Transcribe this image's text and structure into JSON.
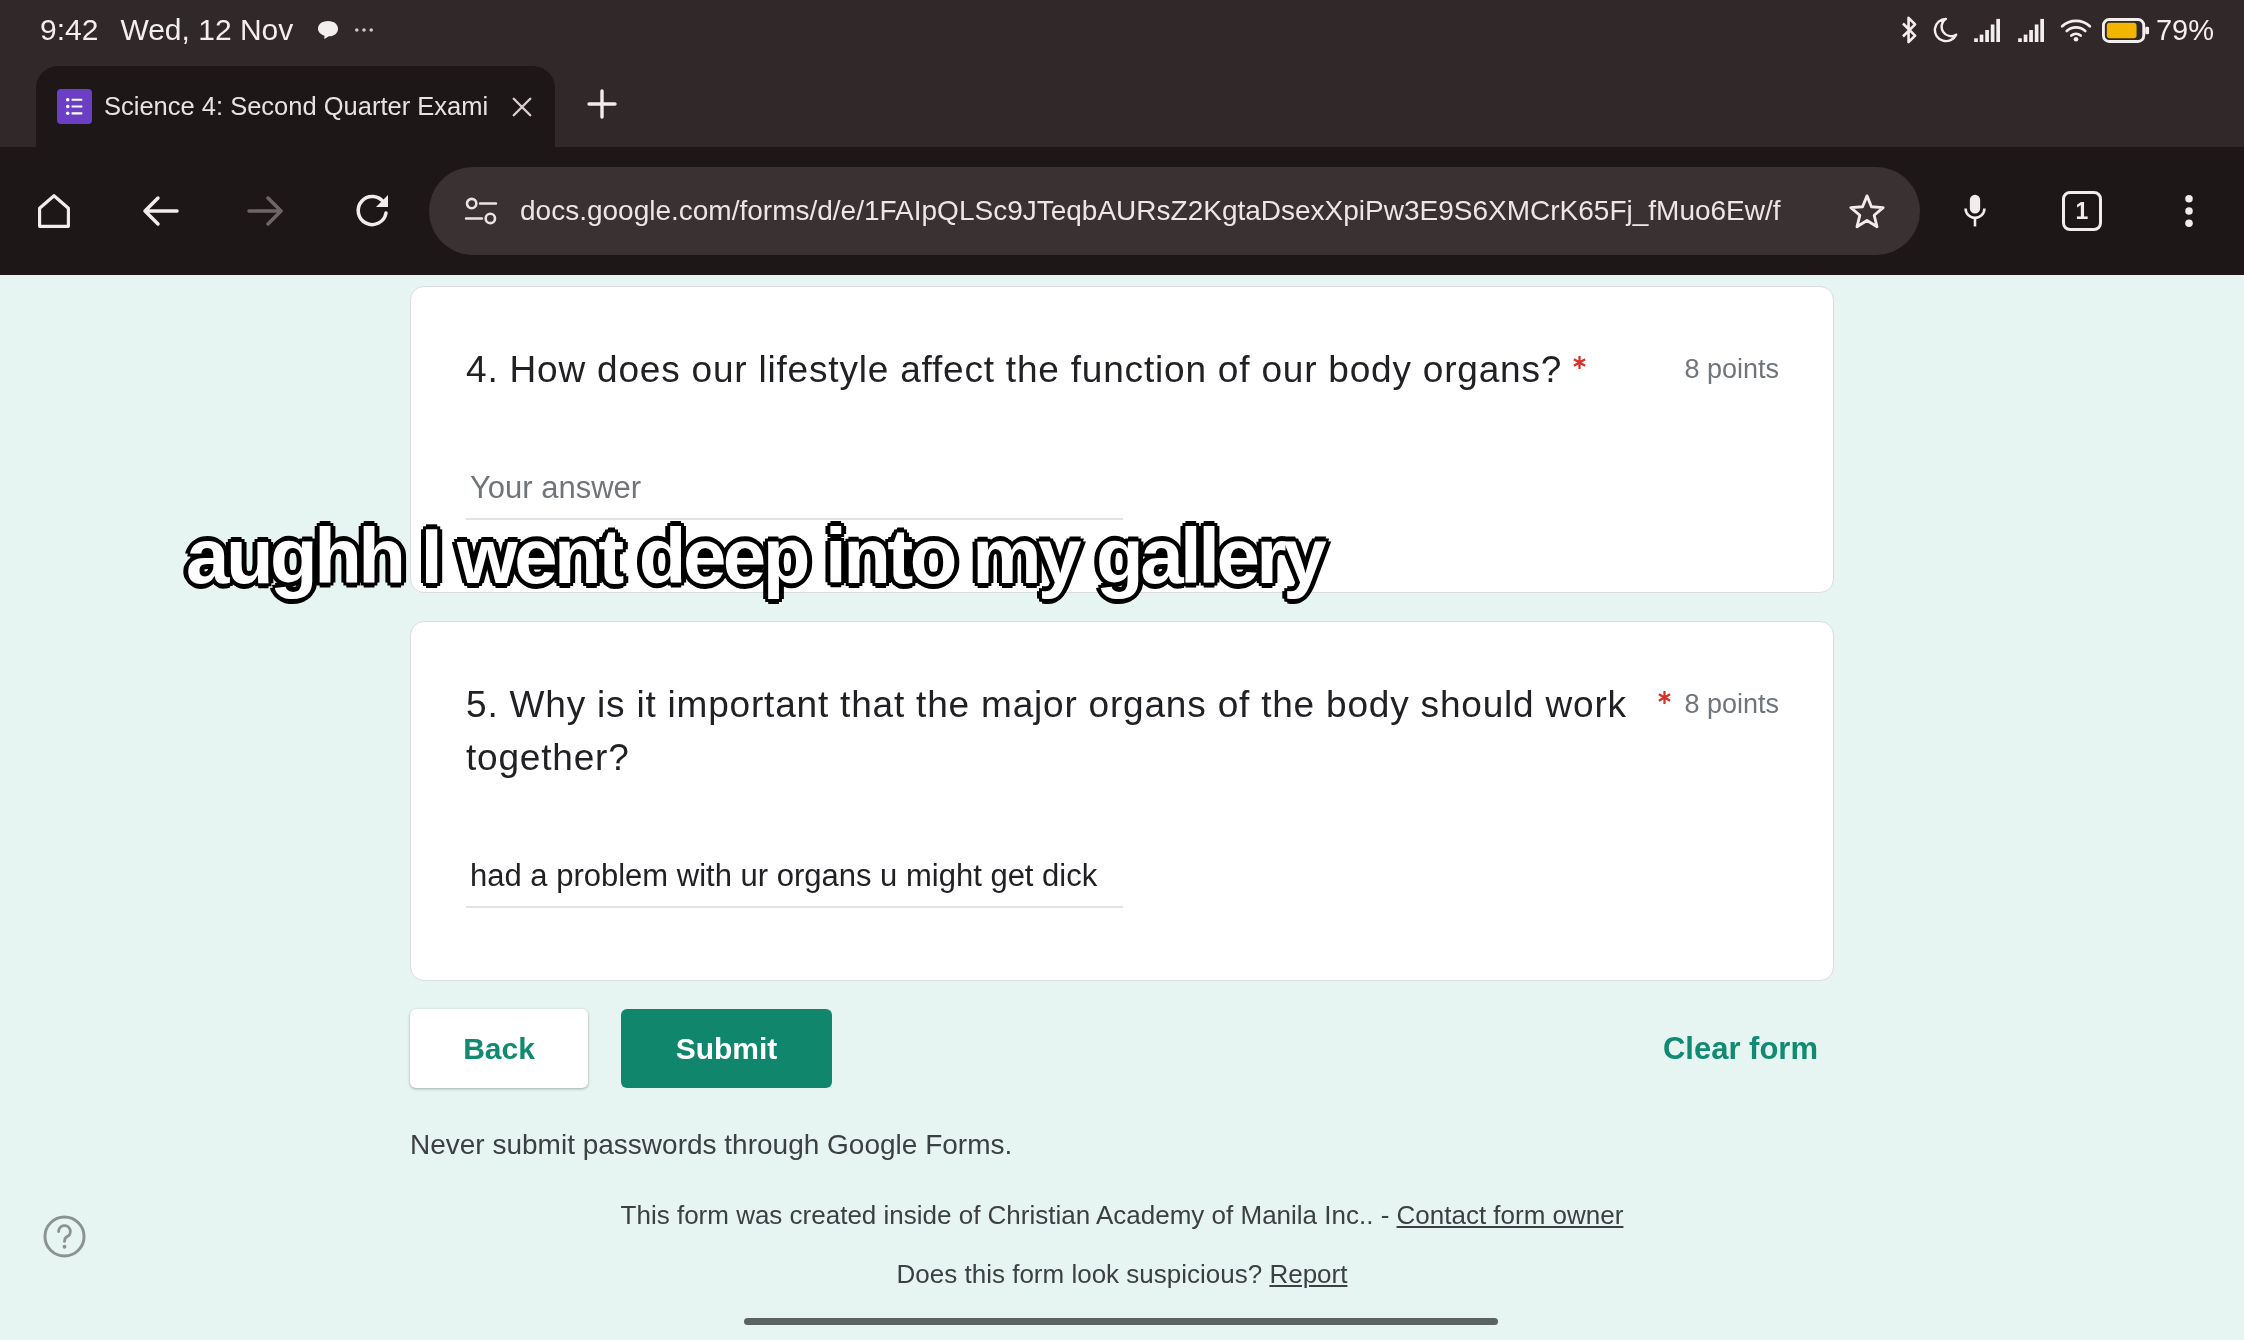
{
  "status_bar": {
    "time": "9:42",
    "date": "Wed, 12 Nov",
    "battery": "79%"
  },
  "browser_tabs": [
    {
      "title": "Science 4: Second Quarter Exami",
      "selected": true
    }
  ],
  "toolbar": {
    "nav_buttons": [
      {
        "kind": "home",
        "disabled": false
      },
      {
        "kind": "back",
        "disabled": false
      },
      {
        "kind": "forward",
        "disabled": true
      },
      {
        "kind": "reload",
        "disabled": false
      }
    ],
    "url": "docs.google.com/forms/d/e/1FAIpQLSc9JTeqbAURsZ2KgtaDsexXpiPw3E9S6XMCrK65Fj_fMuo6Ew/f",
    "tab_count": "1"
  },
  "form": {
    "questions": [
      {
        "text": "4. How does our lifestyle affect the function of our body organs?",
        "required": true,
        "points": "8 points",
        "answer": {
          "placeholder": "Your answer"
        }
      },
      {
        "text": "5. Why is it important that the major organs of the body should work together?",
        "required": true,
        "points": "8 points",
        "answer": {
          "value": "had a problem with ur organs u might get dick"
        }
      }
    ],
    "buttons": [
      {
        "kind": "back",
        "label": "Back"
      },
      {
        "kind": "submit",
        "label": "Submit"
      }
    ],
    "clear_form": "Clear form",
    "notice": "Never submit passwords through Google Forms.",
    "footer": {
      "text": "This form was created inside of Christian Academy of Manila Inc.. -",
      "link": "Contact form owner"
    },
    "report": {
      "text": "Does this form look suspicious?",
      "link": "Report"
    }
  },
  "caption_overlay": {
    "text": "aughh I went deep into my gallery"
  }
}
